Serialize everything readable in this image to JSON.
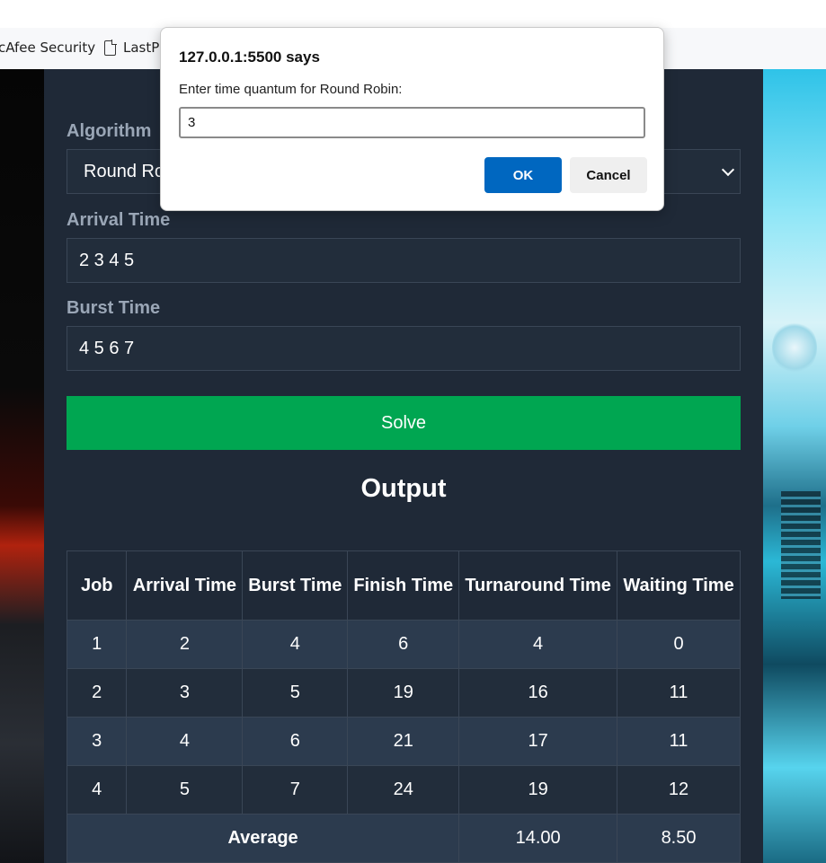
{
  "bookmarks": [
    {
      "label": "cAfee Security"
    },
    {
      "label": "LastP",
      "icon": "document-icon"
    }
  ],
  "form": {
    "algorithm_label": "Algorithm",
    "algorithm_value": "Round Ro",
    "arrival_label": "Arrival Time",
    "arrival_value": "2 3 4 5",
    "burst_label": "Burst Time",
    "burst_value": "4 5 6 7",
    "solve_label": "Solve"
  },
  "output": {
    "title": "Output",
    "headers": [
      "Job",
      "Arrival Time",
      "Burst Time",
      "Finish Time",
      "Turnaround Time",
      "Waiting Time"
    ],
    "rows": [
      [
        "1",
        "2",
        "4",
        "6",
        "4",
        "0"
      ],
      [
        "2",
        "3",
        "5",
        "19",
        "16",
        "11"
      ],
      [
        "3",
        "4",
        "6",
        "21",
        "17",
        "11"
      ],
      [
        "4",
        "5",
        "7",
        "24",
        "19",
        "12"
      ]
    ],
    "average": {
      "label": "Average",
      "turnaround": "14.00",
      "waiting": "8.50"
    }
  },
  "dialog": {
    "title": "127.0.0.1:5500 says",
    "message": "Enter time quantum for Round Robin:",
    "input_value": "3",
    "ok_label": "OK",
    "cancel_label": "Cancel"
  },
  "colors": {
    "panel": "#1f2937",
    "solve": "#00a651",
    "ok_button": "#0067c0"
  }
}
